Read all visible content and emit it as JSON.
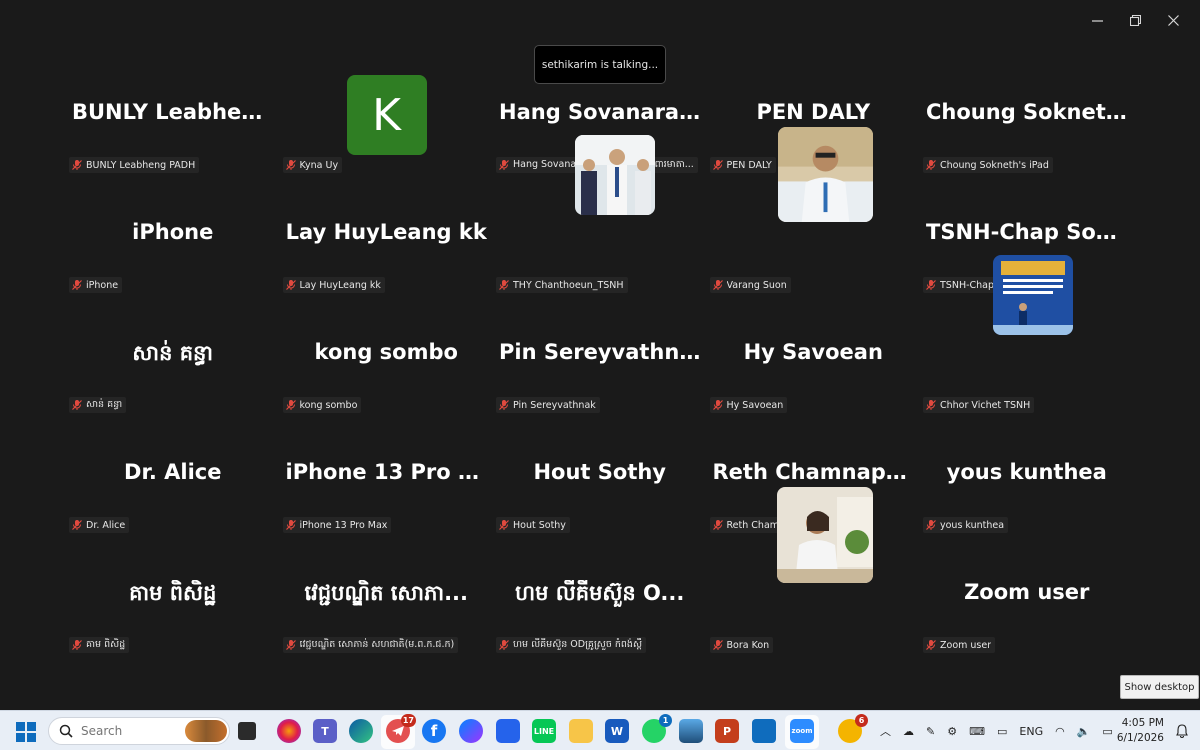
{
  "window": {
    "minimize_icon": "minimize-icon",
    "restore_icon": "restore-icon",
    "close_icon": "close-icon"
  },
  "speaking_indicator": "sethikarim is talking...",
  "participants": [
    {
      "display": "BUNLY  Leabhen...",
      "label": "BUNLY Leabheng PADH"
    },
    {
      "display": "",
      "avatar_letter": "K",
      "avatar_color": "#2f7e23",
      "label": "Kyna Uy"
    },
    {
      "display": "Hang  Sovanara...",
      "label": "Hang Sovanara មជ្ឈមណ្ឌលជាតិគាំពារមាតា..."
    },
    {
      "display": "PEN DALY",
      "label": "PEN DALY"
    },
    {
      "display": "Choung  Sokneth...",
      "label": "Choung Sokneth's iPad"
    },
    {
      "display": "iPhone",
      "label": "iPhone"
    },
    {
      "display": "Lay HuyLeang kk",
      "label": "Lay HuyLeang kk"
    },
    {
      "display": "",
      "photo": "group-photo",
      "label": "THY Chanthoeun_TSNH"
    },
    {
      "display": "",
      "photo": "man-photo",
      "label": "Varang Suon"
    },
    {
      "display": "TSNH-Chap  Soni...",
      "label": "TSNH-Chap Sonika"
    },
    {
      "display": "សាន់ គន្ធា",
      "label": "សាន់ គន្ធា"
    },
    {
      "display": "kong sombo",
      "label": "kong sombo"
    },
    {
      "display": "Pin Sereyvathnak",
      "label": "Pin Sereyvathnak"
    },
    {
      "display": "Hy Savoean",
      "label": "Hy Savoean"
    },
    {
      "display": "",
      "photo": "poster-photo",
      "label": "Chhor Vichet TSNH"
    },
    {
      "display": "Dr. Alice",
      "label": "Dr. Alice"
    },
    {
      "display": "iPhone  13  Pro  M...",
      "label": "iPhone 13 Pro Max"
    },
    {
      "display": "Hout Sothy",
      "label": "Hout Sothy"
    },
    {
      "display": "Reth  Chamnap_...",
      "label": "Reth Chamnap_KSP PHD"
    },
    {
      "display": "yous kunthea",
      "label": "yous kunthea"
    },
    {
      "display": "គាម ពិសិដ្ឋ",
      "label": "គាម ពិសិដ្ឋ"
    },
    {
      "display": "វេជ្ជបណ្ឌិត សោភា...",
      "label": "វេជ្ជបណ្ឌិត សោភាន់ សហជាតិ(ម.ព.ក.ជ.ក)"
    },
    {
      "display": "ហម លីគីមស៊ួន O...",
      "label": "ហម លីគីមស៊ួន ODគ្រូស្រួច កំពង់ស្ពឺ"
    },
    {
      "display": "",
      "photo": "woman-photo",
      "label": "Bora Kon"
    },
    {
      "display": "Zoom user",
      "label": "Zoom user"
    }
  ],
  "show_desktop": "Show desktop",
  "taskbar": {
    "search_placeholder": "Search",
    "telegram_badge": "17",
    "whatsapp_badge": "1",
    "zoom_label": "zoom",
    "tray_badge": "6",
    "language": "ENG",
    "time": "4:05 PM",
    "date": "6/1/2026"
  },
  "colors": {
    "background": "#1a1a1a",
    "avatar_green": "#2f7e23",
    "muted_red": "#e04a3f",
    "taskbar": "#e8eef6"
  }
}
